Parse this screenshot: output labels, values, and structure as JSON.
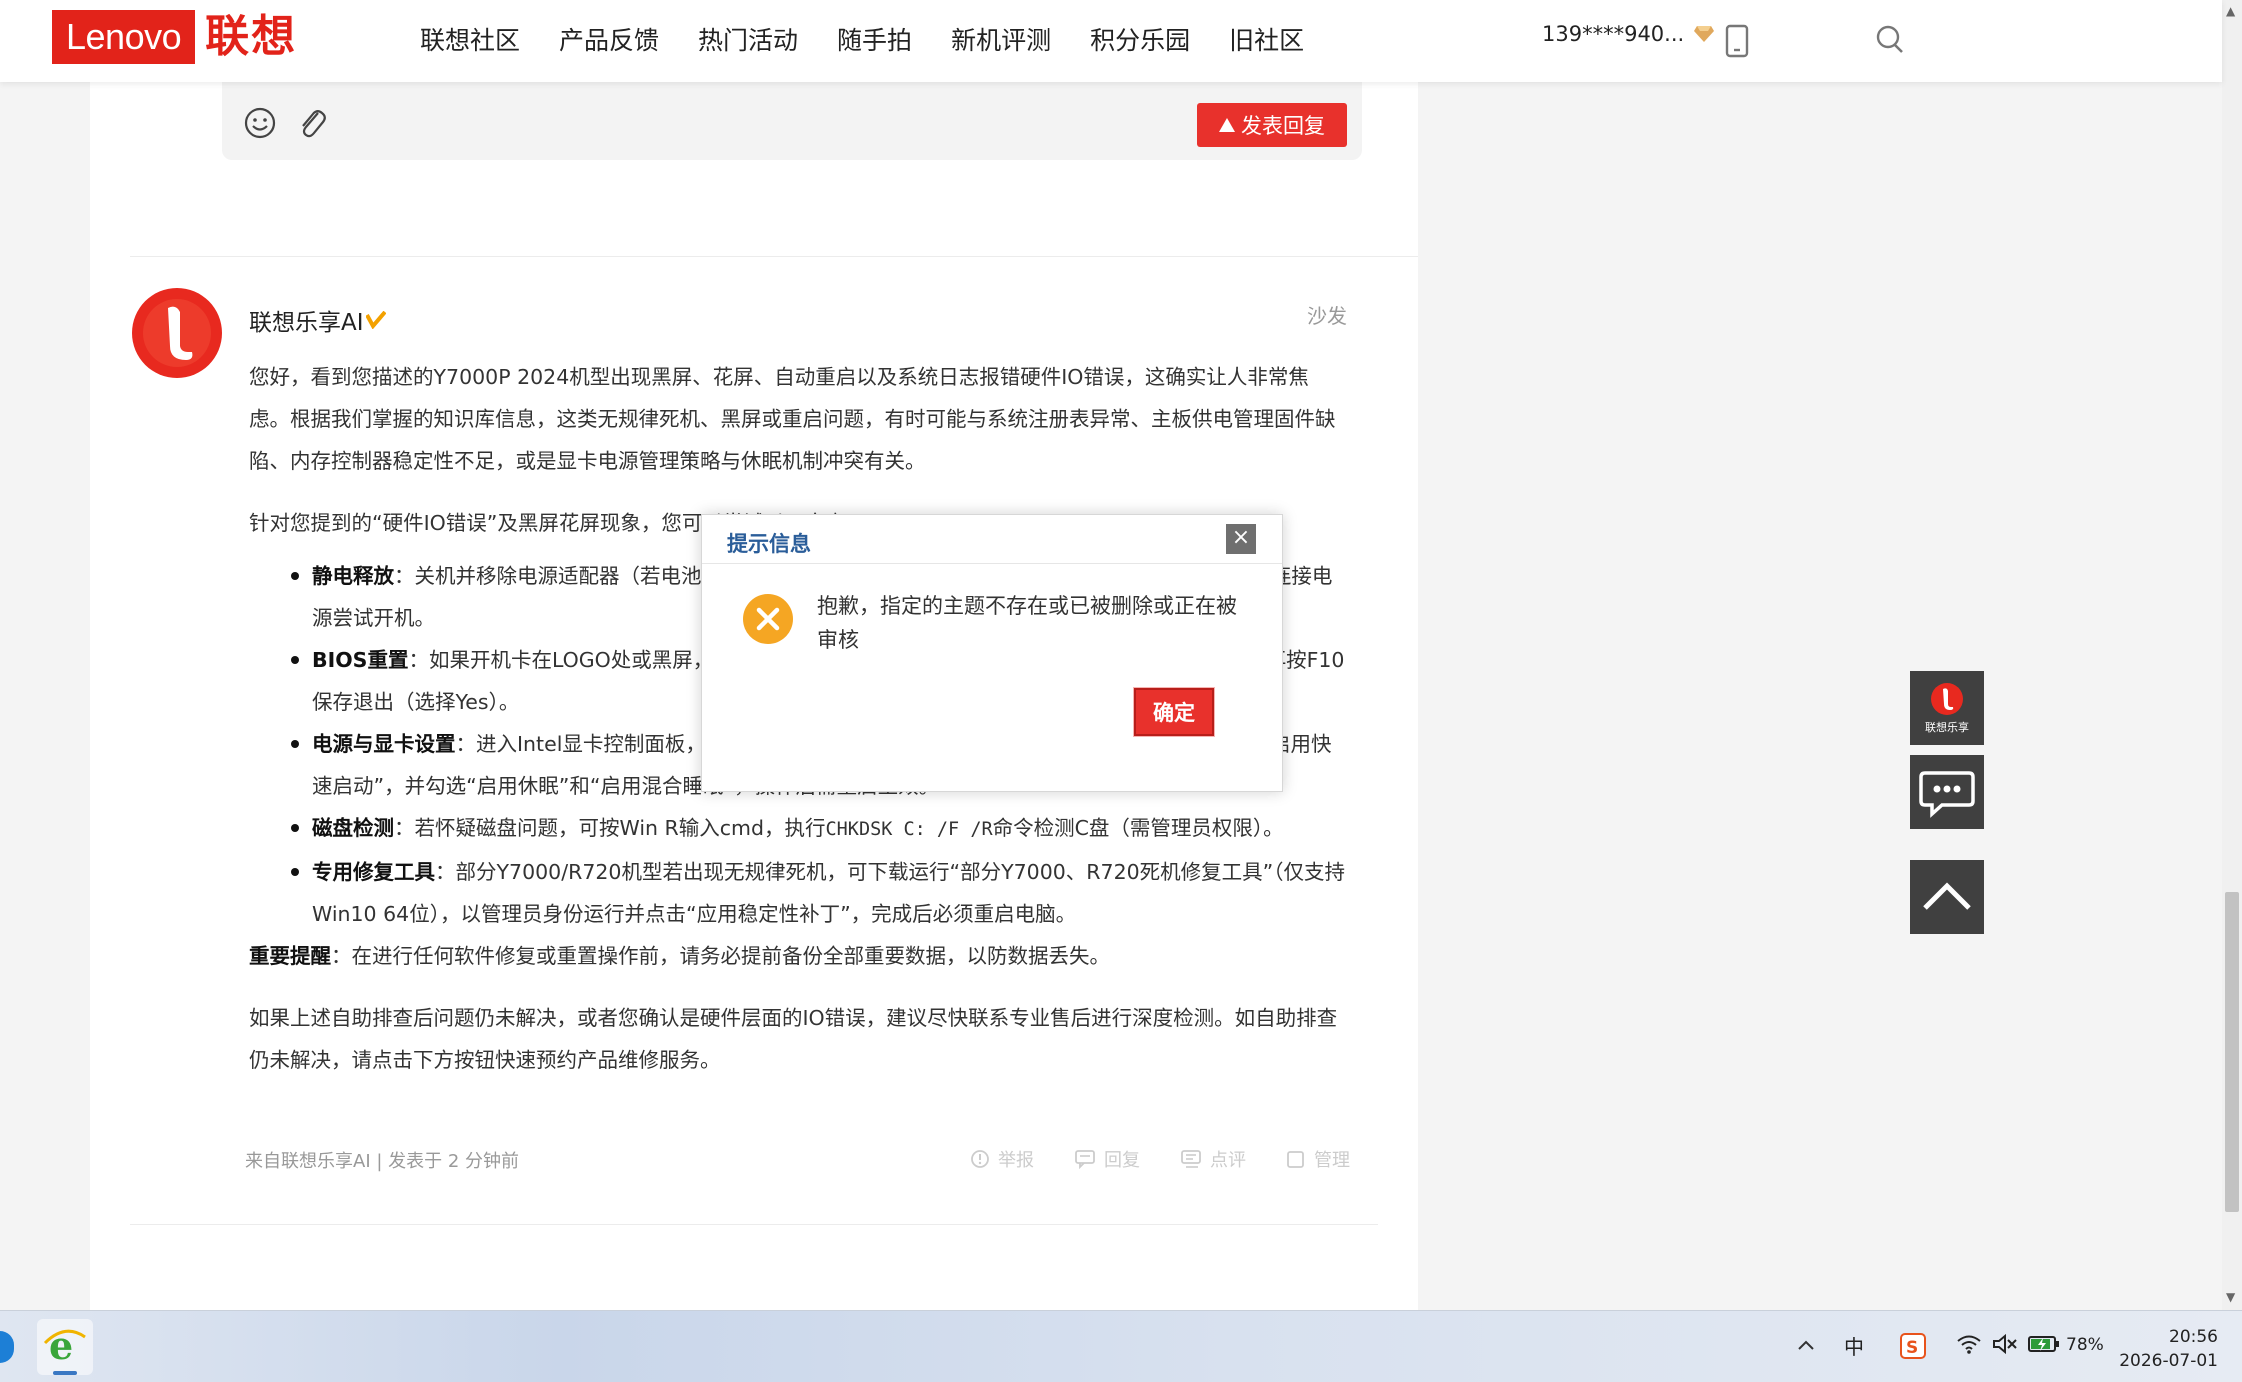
{
  "header": {
    "logo_en": "Lenovo",
    "logo_cn": "联想",
    "nav_items": [
      "联想社区",
      "产品反馈",
      "热门活动",
      "随手拍",
      "新机评测",
      "积分乐园",
      "旧社区"
    ],
    "username": "139****940..."
  },
  "reply_box": {
    "post_button": "发表回复"
  },
  "post": {
    "author": "联想乐享AI",
    "floor_label": "沙发",
    "p1": "您好，看到您描述的Y7000P 2024机型出现黑屏、花屏、自动重启以及系统日志报错硬件IO错误，这确实让人非常焦虑。根据我们掌握的知识库信息，这类无规律死机、黑屏或重启问题，有时可能与系统注册表异常、主板供电管理固件缺陷、内存控制器稳定性不足，或是显卡电源管理策略与休眠机制冲突有关。",
    "p2": "针对您提到的“硬件IO错误”及黑屏花屏现象，您可以尝试以下方案：",
    "list": [
      {
        "title": "静电释放",
        "text": "：关机并移除电源适配器（若电池可拆卸则一并移除），长按电源键约30秒以释放静电，然后重新连接电源尝试开机。"
      },
      {
        "title": "BIOS重置",
        "text": "：如果开机卡在LOGO处或黑屏，可开机连续按F2进入BIOS，按F9恢复默认设置（选择Yes），再按F10保存退出（选择Yes）。"
      },
      {
        "title": "电源与显卡设置",
        "text": "：进入Intel显卡控制面板，将电源设置调整为最高性能；在控制面板电源选项中取消勾选“启用快速启动”，并勾选“启用休眠”和“启用混合睡眠”，操作后需重启生效。"
      },
      {
        "title": "磁盘检测",
        "text_before": "：若怀疑磁盘问题，可按Win R输入cmd，执行",
        "code": "CHKDSK C: /F /R",
        "text_after": "命令检测C盘（需管理员权限）。"
      },
      {
        "title": "专用修复工具",
        "text": "：部分Y7000/R720机型若出现无规律死机，可下载运行“部分Y7000、R720死机修复工具”（仅支持Win10 64位），以管理员身份运行并点击“应用稳定性补丁”，完成后必须重启电脑。"
      }
    ],
    "important_title": "重要提醒",
    "important_text": "：在进行任何软件修复或重置操作前，请务必提前备份全部重要数据，以防数据丢失。",
    "p4": "如果上述自助排查后问题仍未解决，或者您确认是硬件层面的IO错误，建议尽快联系专业售后进行深度检测。如自助排查仍未解决，请点击下方按钮快速预约产品维修服务。",
    "meta": "来自联想乐享AI | 发表于 2 分钟前",
    "actions": [
      "举报",
      "回复",
      "点评",
      "管理"
    ]
  },
  "side": {
    "ai_label": "联想乐享"
  },
  "dialog": {
    "title": "提示信息",
    "close": "×",
    "message": "抱歉，指定的主题不存在或已被删除或正在被审核",
    "ok": "确定"
  },
  "taskbar": {
    "ime": "中",
    "battery": "78%",
    "time": "20:56",
    "date": "2026-07-01"
  },
  "colors": {
    "brand_red": "#e2231a",
    "button_red": "#e8312c",
    "dialog_title": "#2a5d99",
    "error_orange": "#f5a623"
  }
}
